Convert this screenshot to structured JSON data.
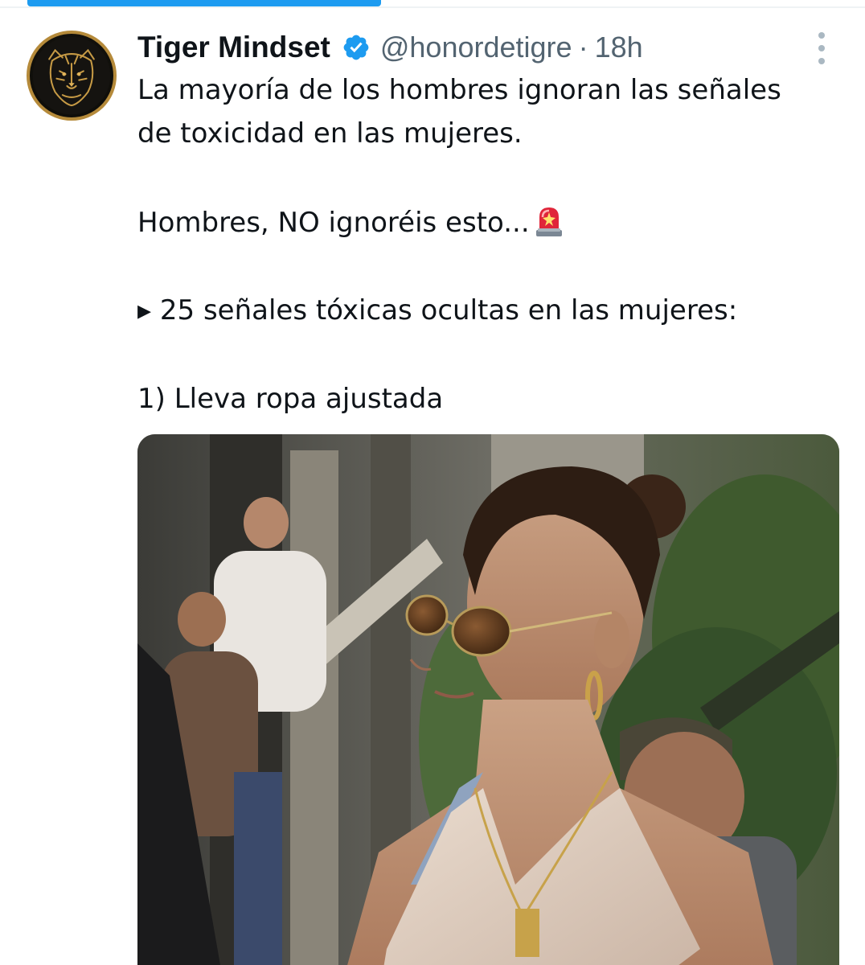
{
  "tweet": {
    "author_name": "Tiger Mindset",
    "handle": "@honordetigre",
    "separator": "·",
    "time": "18h",
    "lines": [
      "La mayoría de los hombres ignoran las señales",
      "de toxicidad en las mujeres.",
      "Hombres, NO ignoréis esto...",
      "▸ 25 señales tóxicas ocultas en las mujeres:",
      "1) Lleva ropa ajustada"
    ],
    "emoji": "rotating-light-icon"
  },
  "colors": {
    "accent": "#1d9bf0",
    "text": "#0f1419",
    "secondary": "#536471",
    "avatar_ring": "#b58a3a"
  }
}
